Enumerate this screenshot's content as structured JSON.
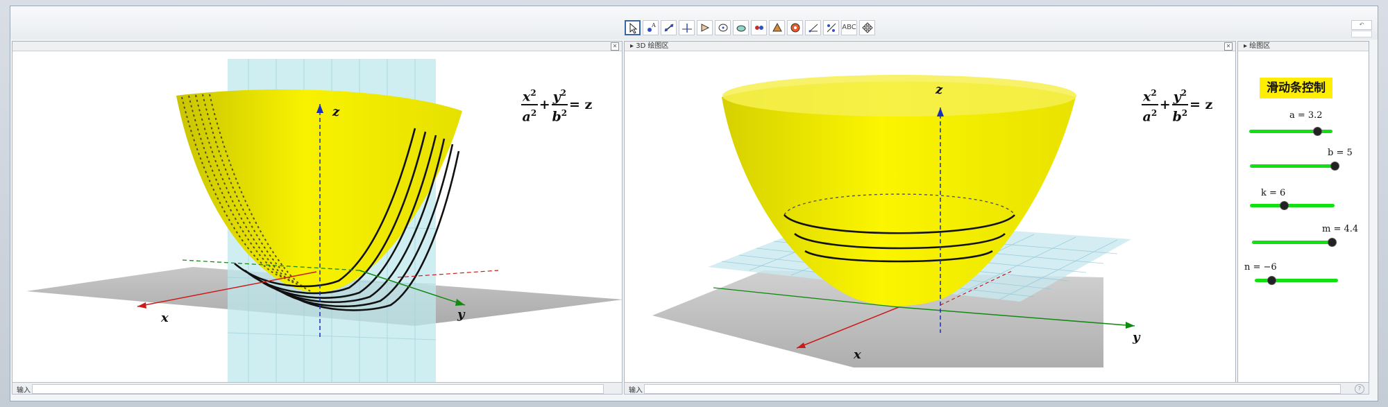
{
  "toolbar": {
    "tools": [
      {
        "name": "move-tool",
        "label": "",
        "active": true
      },
      {
        "name": "point-tool",
        "label": ""
      },
      {
        "name": "line-tool",
        "label": ""
      },
      {
        "name": "perpendicular-tool",
        "label": ""
      },
      {
        "name": "polygon-tool",
        "label": ""
      },
      {
        "name": "circle-tool",
        "label": ""
      },
      {
        "name": "intersect-surface-tool",
        "label": ""
      },
      {
        "name": "plane-tool",
        "label": ""
      },
      {
        "name": "pyramid-tool",
        "label": ""
      },
      {
        "name": "sphere-tool",
        "label": ""
      },
      {
        "name": "angle-tool",
        "label": ""
      },
      {
        "name": "reflect-tool",
        "label": ""
      },
      {
        "name": "text-tool",
        "label": "ABC"
      },
      {
        "name": "move-view-tool",
        "label": ""
      }
    ]
  },
  "panels": {
    "left_3d": {
      "title": "",
      "close": "✕"
    },
    "right_3d": {
      "title": "3D 绘图区",
      "close": "✕"
    },
    "graphics": {
      "title": "绘图区",
      "close": "✕"
    }
  },
  "formula": {
    "x_num": "x",
    "y_num": "y",
    "a_den": "a",
    "b_den": "b",
    "rhs": "= z",
    "plus": "+",
    "exp": "2"
  },
  "axes": {
    "x": "x",
    "y": "y",
    "z": "z"
  },
  "sliders_title": "滑动条控制",
  "sliders": [
    {
      "label": "a = 3.2",
      "value": 3.2,
      "min": -5,
      "max": 5
    },
    {
      "label": "b = 5",
      "value": 5,
      "min": -5,
      "max": 5
    },
    {
      "label": "k = 6",
      "value": 6,
      "min": 0,
      "max": 15
    },
    {
      "label": "m = 4.4",
      "value": 4.4,
      "min": -5,
      "max": 5
    },
    {
      "label": "n = −6",
      "value": -6,
      "min": -10,
      "max": 10
    }
  ],
  "input_bar": {
    "label": "输入"
  },
  "colors": {
    "surface": "#f2ee00",
    "plane": "#bfe8ee",
    "x_axis": "#cc1a1a",
    "y_axis": "#128a12",
    "z_axis": "#1a2fb8",
    "slider": "#12e012",
    "badge": "#ffee00"
  }
}
